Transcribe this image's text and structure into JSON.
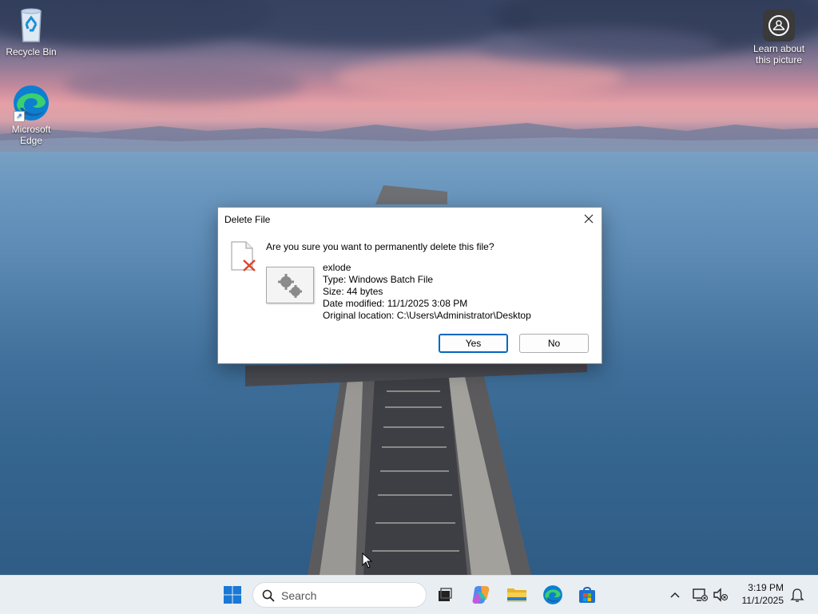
{
  "desktop": {
    "icons": [
      {
        "label": "Recycle Bin"
      },
      {
        "label": "Microsoft Edge"
      }
    ],
    "spotlight": {
      "label": "Learn about this picture"
    }
  },
  "dialog": {
    "title": "Delete File",
    "question": "Are you sure you want to permanently delete this file?",
    "file": {
      "name": "exlode",
      "type": "Type: Windows Batch File",
      "size": "Size: 44 bytes",
      "modified": "Date modified: 11/1/2025 3:08 PM",
      "location": "Original location: C:\\Users\\Administrator\\Desktop"
    },
    "yes_label": "Yes",
    "no_label": "No"
  },
  "taskbar": {
    "search_placeholder": "Search",
    "clock": {
      "time": "3:19 PM",
      "date": "11/1/2025"
    }
  },
  "colors": {
    "accent": "#0067c0",
    "taskbar_bg": "#e9eef3"
  }
}
